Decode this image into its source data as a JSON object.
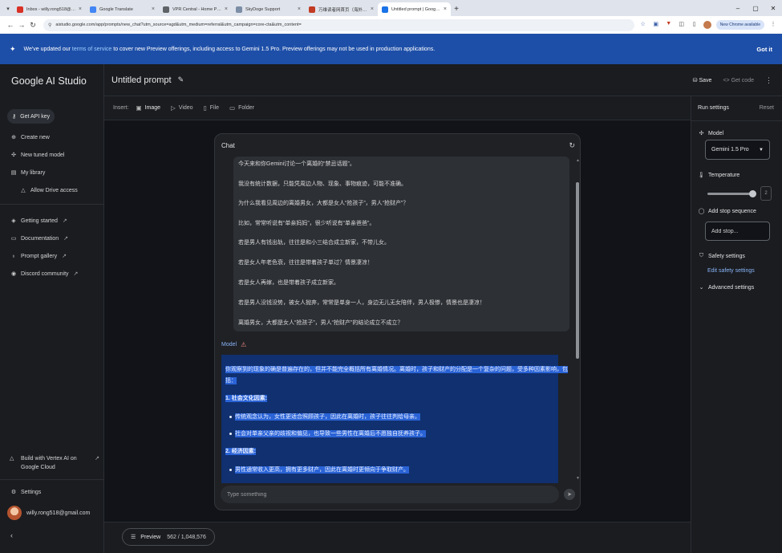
{
  "browser": {
    "tabs": [
      {
        "title": "Inbox - willy.rong518@gmail.c",
        "fav": "#d93025"
      },
      {
        "title": "Google Translate",
        "fav": "#4285f4"
      },
      {
        "title": "VPR Central - Home Page",
        "fav": "#5f6368"
      },
      {
        "title": "SkyDoge Support",
        "fav": "#7c8ea6"
      },
      {
        "title": "万维读者网首页（海外版）",
        "fav": "#c23b22"
      },
      {
        "title": "Untitled prompt | Google AI St",
        "fav": "#1a73e8"
      }
    ],
    "url": "aistudio.google.com/app/prompts/new_chat?utm_source=agd&utm_medium=referral&utm_campaign=core-cta&utm_content=",
    "chrome_badge": "New Chrome available"
  },
  "banner": {
    "prefix": "We've updated our ",
    "link": "terms of service",
    "suffix": " to cover new Preview offerings, including access to Gemini 1.5 Pro. Preview offerings may not be used in production applications.",
    "action": "Got it"
  },
  "sidebar": {
    "logo": "Google AI Studio",
    "api_key": "Get API key",
    "items": [
      {
        "label": "Create new"
      },
      {
        "label": "New tuned model"
      },
      {
        "label": "My library"
      },
      {
        "label": "Allow Drive access"
      },
      {
        "label": "Getting started"
      },
      {
        "label": "Documentation"
      },
      {
        "label": "Prompt gallery"
      },
      {
        "label": "Discord community"
      }
    ],
    "vertex": "Build with Vertex AI on Google Cloud",
    "settings": "Settings",
    "user_email": "willy.rong518@gmail.com"
  },
  "header": {
    "title": "Untitled prompt",
    "save": "Save",
    "get_code": "Get code"
  },
  "insert": {
    "label": "Insert:",
    "items": [
      "Image",
      "Video",
      "File",
      "Folder"
    ]
  },
  "chat": {
    "title": "Chat",
    "user_lines": [
      "今天来和你Gemini讨论一个离婚的“禁忌话题”。",
      "我没有统计数据，只能凭周边人物、现象、事物痕迹，可能不准确。",
      "为什么我看见周边的离婚男女，大都是女人“抢孩子”，男人“抢财产”？",
      "比如，常常听说有“单亲妈妈”，很少听说有“单亲爸爸”。",
      "若是男人有钱出轨，往往是和小三结合成立新家，不带儿女。",
      "若是女人年老色衰，往往是带着孩子单过？情景凄凉！",
      "若是女人再嫁，也是带着孩子成立新家。",
      "若是男人没钱没势，被女人抛弃，常常是单身一人，身边无儿无女陪伴，男人极惨，情景也是凄凉！",
      "离婚男女，大都是女人“抢孩子”，男人“抢财产”的结论成立不成立？"
    ],
    "model_label": "Model",
    "model_lines": [
      "你观察到的现象的确是普遍存在的，但并不能完全概括所有离婚情况。离婚时，孩子和财产的分配是一个复杂的问题，受多种因素影响，包",
      "括：",
      "1. 社会文化因素:",
      "传统观念认为，女性更适合照顾孩子，因此在离婚时，孩子往往判给母亲。",
      "社会对单亲父亲的歧视和偏见，也导致一些男性在离婚后不愿独自抚养孩子。",
      "2. 经济因素:",
      "男性通常收入更高，拥有更多财产，因此在离婚时更倾向于争取财产。"
    ],
    "input_placeholder": "Type something"
  },
  "footer": {
    "preview": "Preview",
    "tokens": "562 / 1,048,576"
  },
  "run_settings": {
    "title": "Run settings",
    "reset": "Reset",
    "model_label": "Model",
    "model_value": "Gemini 1.5 Pro",
    "temperature_label": "Temperature",
    "temperature_value": "2",
    "temperature_fraction": 1.0,
    "stop_label": "Add stop sequence",
    "stop_placeholder": "Add stop...",
    "safety_label": "Safety settings",
    "edit_safety": "Edit safety settings",
    "advanced": "Advanced settings"
  }
}
